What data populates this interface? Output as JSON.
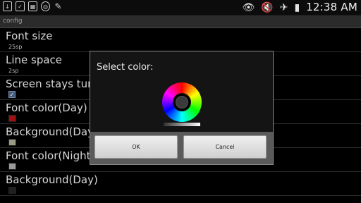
{
  "statusbar": {
    "left_icons": [
      "download-icon",
      "clipboard-icon",
      "calendar-icon",
      "circle-app-icon",
      "pen-icon"
    ],
    "right_icons": [
      "eye-icon",
      "muted-icon",
      "airplane-icon",
      "battery-icon"
    ],
    "time": "12:38 AM"
  },
  "app": {
    "title": "config"
  },
  "prefs": [
    {
      "title": "Font size",
      "summary": "25sp"
    },
    {
      "title": "Line space",
      "summary": "2sp"
    },
    {
      "title": "Screen stays turn on",
      "checked": true
    },
    {
      "title": "Font color(Day)",
      "swatch": "#a01010"
    },
    {
      "title": "Background(Day)",
      "swatch": "#9a9a86"
    },
    {
      "title": "Font color(Night)",
      "swatch": "#9a9a9a"
    },
    {
      "title": "Background(Day)",
      "swatch": "#202020"
    }
  ],
  "dialog": {
    "title": "Select color:",
    "ok_label": "OK",
    "cancel_label": "Cancel"
  }
}
